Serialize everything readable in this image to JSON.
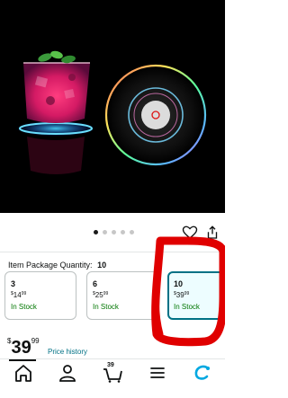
{
  "gallery": {
    "dots_total": 5,
    "active_dot": 0
  },
  "quantity": {
    "label": "Item Package Quantity:",
    "value": "10"
  },
  "options": [
    {
      "qty": "3",
      "currency": "$",
      "whole": "14",
      "cents": "99",
      "stock": "In Stock",
      "selected": false
    },
    {
      "qty": "6",
      "currency": "$",
      "whole": "25",
      "cents": "99",
      "stock": "In Stock",
      "selected": false
    },
    {
      "qty": "10",
      "currency": "$",
      "whole": "39",
      "cents": "99",
      "stock": "In Stock",
      "selected": true
    }
  ],
  "price": {
    "currency": "$",
    "whole": "39",
    "cents": "99",
    "history_link": "Price history"
  },
  "nav": {
    "cart_count": "39",
    "items": [
      "home-icon",
      "account-icon",
      "cart-icon",
      "menu-icon",
      "rufus-icon"
    ]
  },
  "colors": {
    "stock_green": "#007600",
    "link_teal": "#007185",
    "selected_bg": "#edfdff",
    "annotation_red": "#e00000",
    "nav_accent": "#00a8e1"
  }
}
